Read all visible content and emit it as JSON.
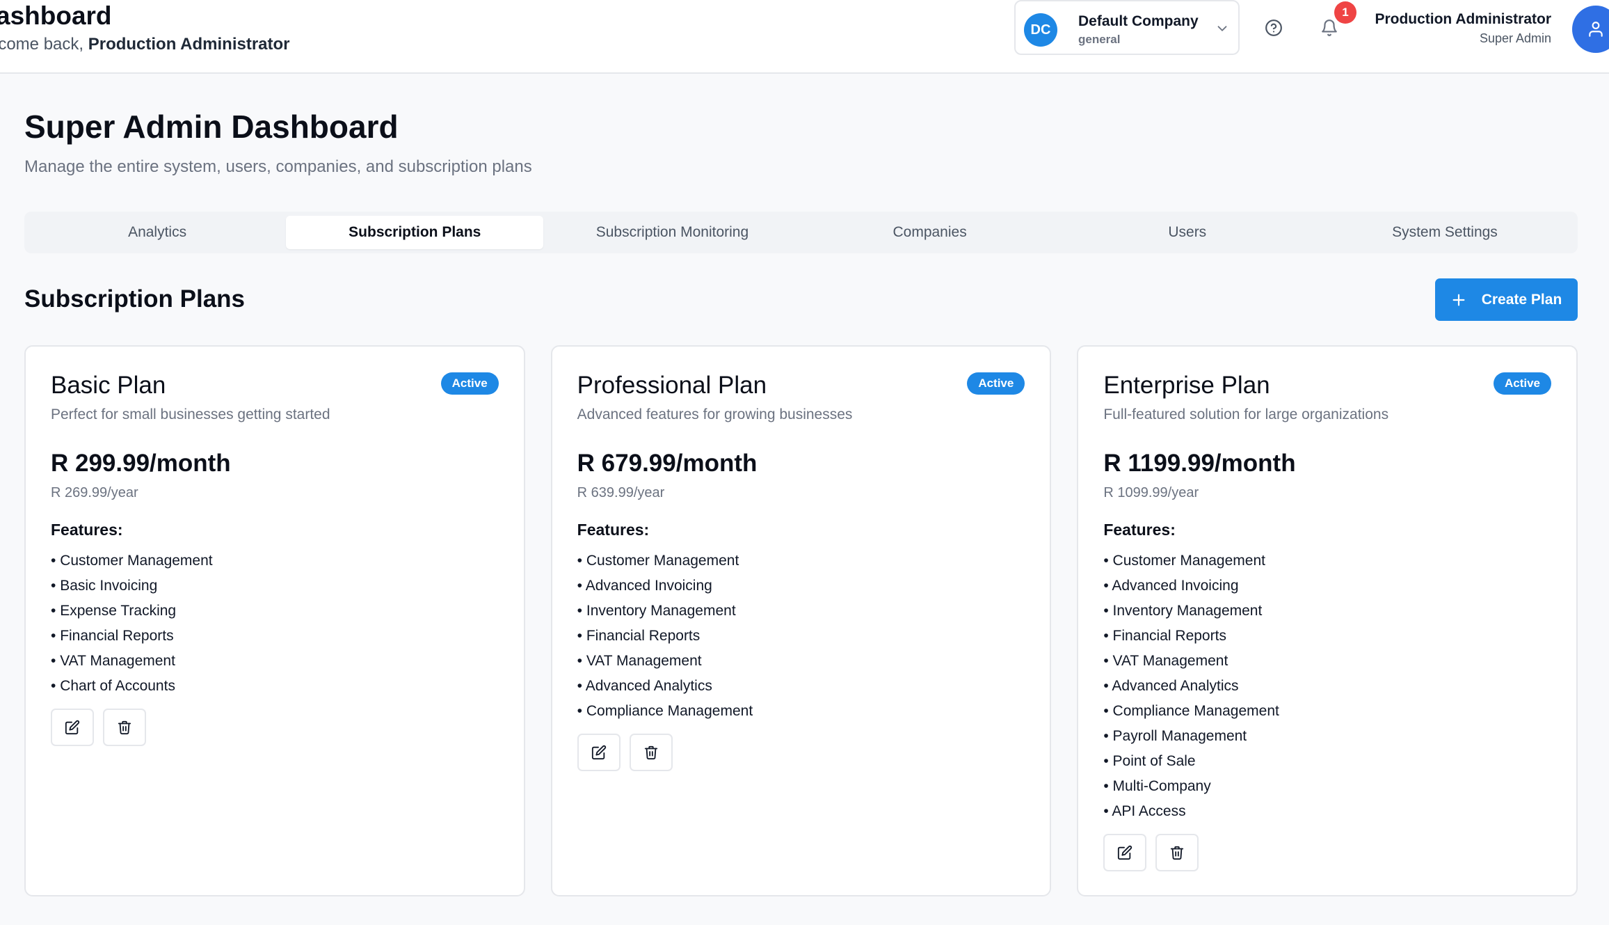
{
  "header": {
    "title": "ashboard",
    "welcome_prefix": "lcome back, ",
    "welcome_name": "Production Administrator",
    "company": {
      "initials": "DC",
      "name": "Default Company",
      "subtitle": "general"
    },
    "notifications_count": "1",
    "user": {
      "name": "Production Administrator",
      "role": "Super Admin"
    }
  },
  "page": {
    "title": "Super Admin Dashboard",
    "subtitle": "Manage the entire system, users, companies, and subscription plans"
  },
  "tabs": [
    {
      "label": "Analytics",
      "active": false
    },
    {
      "label": "Subscription Plans",
      "active": true
    },
    {
      "label": "Subscription Monitoring",
      "active": false
    },
    {
      "label": "Companies",
      "active": false
    },
    {
      "label": "Users",
      "active": false
    },
    {
      "label": "System Settings",
      "active": false
    }
  ],
  "section": {
    "title": "Subscription Plans",
    "create_label": "Create Plan"
  },
  "plans": [
    {
      "name": "Basic Plan",
      "status": "Active",
      "description": "Perfect for small businesses getting started",
      "price_month": "R 299.99/month",
      "price_year": "R 269.99/year",
      "features_title": "Features:",
      "features": [
        "Customer Management",
        "Basic Invoicing",
        "Expense Tracking",
        "Financial Reports",
        "VAT Management",
        "Chart of Accounts"
      ]
    },
    {
      "name": "Professional Plan",
      "status": "Active",
      "description": "Advanced features for growing businesses",
      "price_month": "R 679.99/month",
      "price_year": "R 639.99/year",
      "features_title": "Features:",
      "features": [
        "Customer Management",
        "Advanced Invoicing",
        "Inventory Management",
        "Financial Reports",
        "VAT Management",
        "Advanced Analytics",
        "Compliance Management"
      ]
    },
    {
      "name": "Enterprise Plan",
      "status": "Active",
      "description": "Full-featured solution for large organizations",
      "price_month": "R 1199.99/month",
      "price_year": "R 1099.99/year",
      "features_title": "Features:",
      "features": [
        "Customer Management",
        "Advanced Invoicing",
        "Inventory Management",
        "Financial Reports",
        "VAT Management",
        "Advanced Analytics",
        "Compliance Management",
        "Payroll Management",
        "Point of Sale",
        "Multi-Company",
        "API Access"
      ]
    }
  ],
  "colors": {
    "accent": "#1e88e5",
    "badge_red": "#ef4444",
    "avatar_blue": "#2f6fe4"
  },
  "icons": {
    "company_chevron": "chevron-down-icon",
    "help": "help-circle-icon",
    "notifications": "bell-icon",
    "user": "user-icon",
    "create": "plus-icon",
    "edit": "edit-icon",
    "delete": "trash-icon"
  }
}
